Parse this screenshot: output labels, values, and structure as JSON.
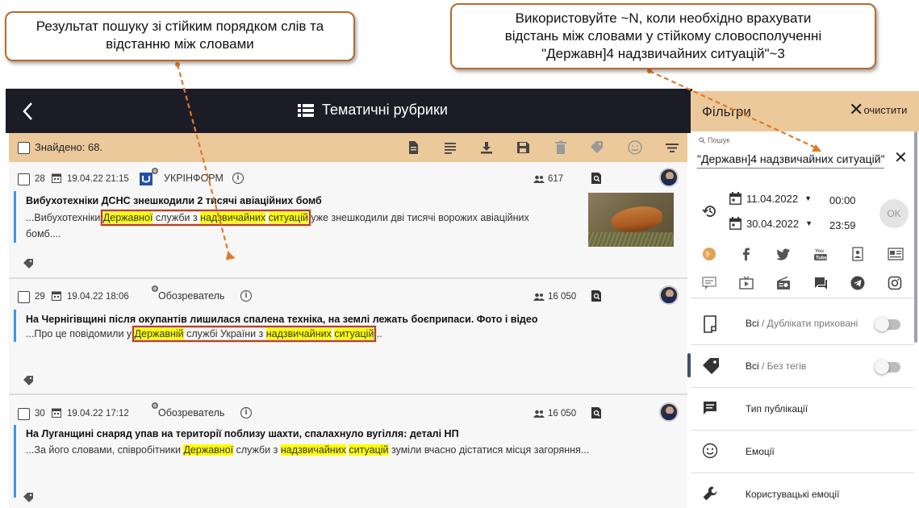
{
  "callouts": {
    "left": [
      "Результат пошуку зі стійким порядком слів та",
      "відстанню між словами"
    ],
    "right": [
      "Використовуйте ~N, коли необхідно врахувати",
      "відстань між словами у  стійкому словосполученні",
      "\"Державн]4  надзвичайних  ситуацій\"~3"
    ]
  },
  "topbar": {
    "title": "Тематичні рубрики"
  },
  "toolbar": {
    "found": "Знайдено: 68."
  },
  "cards": [
    {
      "num": "28",
      "date": "19.04.22 21:15",
      "source": "УКРІНФОРМ",
      "reach": "617",
      "title": "Вибухотехніки ДСНС знешкодили 2 тисячі авіаційних бомб",
      "s1": "...Вибухотехніки ",
      "h1": "Державної",
      "s2": " служби з ",
      "h2": "надзвичайних",
      "s3": " ",
      "h3": "ситуацій",
      "s4": " уже знешкодили дві тисячі ворожих авіаційних",
      "s5": "бомб...."
    },
    {
      "num": "29",
      "date": "19.04.22 18:06",
      "source": "Обозреватель",
      "reach": "16 050",
      "title": "На Чернігівщині після окупантів лишилася спалена техніка, на землі лежать боєприпаси. Фото і відео",
      "s1": "...Про це повідомили у ",
      "h1": "Державній",
      "s2": " службі України з ",
      "h2": "надзвичайних",
      "s3": " ",
      "h3": "ситуацій",
      "s4": "..."
    },
    {
      "num": "30",
      "date": "19.04.22 17:12",
      "source": "Обозреватель",
      "reach": "16 050",
      "title": "На Луганщині снаряд упав на території поблизу шахти, спалахнуло вугілля: деталі НП",
      "s1": "...За його словами, співробітники ",
      "h1": "Державної",
      "s2": " служби з ",
      "h2": "надзвичайних",
      "s3": " ",
      "h3": "ситуацій",
      "s4": " зуміли вчасно дістатися місця загоряння..."
    }
  ],
  "filters": {
    "title": "Фільтри",
    "clear": "очистити",
    "search_label": "Пошук",
    "search_value": "\"Державн]4 надзвичайних ситуацій\"~3",
    "date_from": "11.04.2022",
    "time_from": "00:00",
    "date_to": "30.04.2022",
    "time_to": "23:59",
    "ok": "OK",
    "rows": [
      {
        "main": "Всі",
        "sub": " / Дублікати приховані"
      },
      {
        "main": "Всі",
        "sub": " / Без тегів"
      },
      {
        "main": "Тип публікації",
        "sub": ""
      },
      {
        "main": "Емоції",
        "sub": ""
      },
      {
        "main": "Користувацькі емоції",
        "sub": ""
      }
    ]
  },
  "colors": {
    "accent": "#ecc99b",
    "topbar": "#1b1c26",
    "highlight": "#ffff00",
    "bar": "#3d98e6",
    "callout_border": "#b86a2c"
  }
}
